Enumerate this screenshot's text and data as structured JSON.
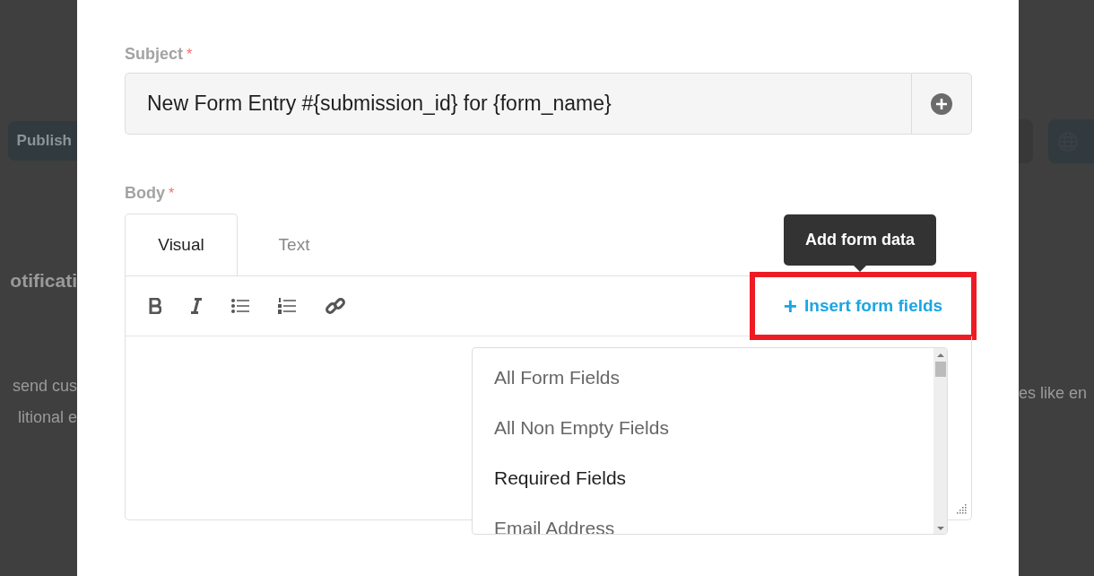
{
  "background": {
    "left": [
      {
        "kind": "button",
        "text": "Publish"
      },
      {
        "kind": "heading",
        "text": "otificati"
      },
      {
        "kind": "text",
        "text": "send cus"
      },
      {
        "kind": "text",
        "text": "litional e"
      }
    ],
    "right": [
      {
        "kind": "button"
      },
      {
        "kind": "text",
        "text": "es like en"
      }
    ]
  },
  "subject": {
    "label": "Subject",
    "required_mark": "*",
    "value": "New Form Entry #{submission_id} for {form_name}"
  },
  "body": {
    "label": "Body",
    "required_mark": "*",
    "tabs": [
      {
        "label": "Visual",
        "selected": true
      },
      {
        "label": "Text",
        "selected": false
      }
    ],
    "insert_button": {
      "label": "Insert form fields",
      "icon": "+",
      "highlighted": true
    },
    "tooltip": "Add form data",
    "dropdown": [
      {
        "label": "All Form Fields",
        "highlighted": false
      },
      {
        "label": "All Non Empty Fields",
        "highlighted": false
      },
      {
        "label": "Required Fields",
        "highlighted": true
      },
      {
        "label": "Email Address",
        "highlighted": false
      }
    ]
  }
}
